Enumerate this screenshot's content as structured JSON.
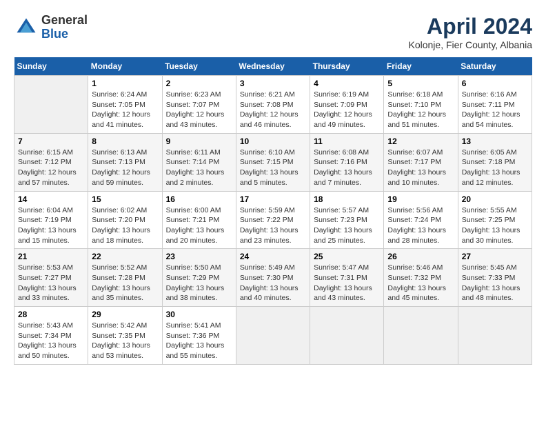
{
  "header": {
    "logo_line1": "General",
    "logo_line2": "Blue",
    "month": "April 2024",
    "location": "Kolonje, Fier County, Albania"
  },
  "weekdays": [
    "Sunday",
    "Monday",
    "Tuesday",
    "Wednesday",
    "Thursday",
    "Friday",
    "Saturday"
  ],
  "weeks": [
    [
      {
        "day": "",
        "sunrise": "",
        "sunset": "",
        "daylight": ""
      },
      {
        "day": "1",
        "sunrise": "Sunrise: 6:24 AM",
        "sunset": "Sunset: 7:05 PM",
        "daylight": "Daylight: 12 hours and 41 minutes."
      },
      {
        "day": "2",
        "sunrise": "Sunrise: 6:23 AM",
        "sunset": "Sunset: 7:07 PM",
        "daylight": "Daylight: 12 hours and 43 minutes."
      },
      {
        "day": "3",
        "sunrise": "Sunrise: 6:21 AM",
        "sunset": "Sunset: 7:08 PM",
        "daylight": "Daylight: 12 hours and 46 minutes."
      },
      {
        "day": "4",
        "sunrise": "Sunrise: 6:19 AM",
        "sunset": "Sunset: 7:09 PM",
        "daylight": "Daylight: 12 hours and 49 minutes."
      },
      {
        "day": "5",
        "sunrise": "Sunrise: 6:18 AM",
        "sunset": "Sunset: 7:10 PM",
        "daylight": "Daylight: 12 hours and 51 minutes."
      },
      {
        "day": "6",
        "sunrise": "Sunrise: 6:16 AM",
        "sunset": "Sunset: 7:11 PM",
        "daylight": "Daylight: 12 hours and 54 minutes."
      }
    ],
    [
      {
        "day": "7",
        "sunrise": "Sunrise: 6:15 AM",
        "sunset": "Sunset: 7:12 PM",
        "daylight": "Daylight: 12 hours and 57 minutes."
      },
      {
        "day": "8",
        "sunrise": "Sunrise: 6:13 AM",
        "sunset": "Sunset: 7:13 PM",
        "daylight": "Daylight: 12 hours and 59 minutes."
      },
      {
        "day": "9",
        "sunrise": "Sunrise: 6:11 AM",
        "sunset": "Sunset: 7:14 PM",
        "daylight": "Daylight: 13 hours and 2 minutes."
      },
      {
        "day": "10",
        "sunrise": "Sunrise: 6:10 AM",
        "sunset": "Sunset: 7:15 PM",
        "daylight": "Daylight: 13 hours and 5 minutes."
      },
      {
        "day": "11",
        "sunrise": "Sunrise: 6:08 AM",
        "sunset": "Sunset: 7:16 PM",
        "daylight": "Daylight: 13 hours and 7 minutes."
      },
      {
        "day": "12",
        "sunrise": "Sunrise: 6:07 AM",
        "sunset": "Sunset: 7:17 PM",
        "daylight": "Daylight: 13 hours and 10 minutes."
      },
      {
        "day": "13",
        "sunrise": "Sunrise: 6:05 AM",
        "sunset": "Sunset: 7:18 PM",
        "daylight": "Daylight: 13 hours and 12 minutes."
      }
    ],
    [
      {
        "day": "14",
        "sunrise": "Sunrise: 6:04 AM",
        "sunset": "Sunset: 7:19 PM",
        "daylight": "Daylight: 13 hours and 15 minutes."
      },
      {
        "day": "15",
        "sunrise": "Sunrise: 6:02 AM",
        "sunset": "Sunset: 7:20 PM",
        "daylight": "Daylight: 13 hours and 18 minutes."
      },
      {
        "day": "16",
        "sunrise": "Sunrise: 6:00 AM",
        "sunset": "Sunset: 7:21 PM",
        "daylight": "Daylight: 13 hours and 20 minutes."
      },
      {
        "day": "17",
        "sunrise": "Sunrise: 5:59 AM",
        "sunset": "Sunset: 7:22 PM",
        "daylight": "Daylight: 13 hours and 23 minutes."
      },
      {
        "day": "18",
        "sunrise": "Sunrise: 5:57 AM",
        "sunset": "Sunset: 7:23 PM",
        "daylight": "Daylight: 13 hours and 25 minutes."
      },
      {
        "day": "19",
        "sunrise": "Sunrise: 5:56 AM",
        "sunset": "Sunset: 7:24 PM",
        "daylight": "Daylight: 13 hours and 28 minutes."
      },
      {
        "day": "20",
        "sunrise": "Sunrise: 5:55 AM",
        "sunset": "Sunset: 7:25 PM",
        "daylight": "Daylight: 13 hours and 30 minutes."
      }
    ],
    [
      {
        "day": "21",
        "sunrise": "Sunrise: 5:53 AM",
        "sunset": "Sunset: 7:27 PM",
        "daylight": "Daylight: 13 hours and 33 minutes."
      },
      {
        "day": "22",
        "sunrise": "Sunrise: 5:52 AM",
        "sunset": "Sunset: 7:28 PM",
        "daylight": "Daylight: 13 hours and 35 minutes."
      },
      {
        "day": "23",
        "sunrise": "Sunrise: 5:50 AM",
        "sunset": "Sunset: 7:29 PM",
        "daylight": "Daylight: 13 hours and 38 minutes."
      },
      {
        "day": "24",
        "sunrise": "Sunrise: 5:49 AM",
        "sunset": "Sunset: 7:30 PM",
        "daylight": "Daylight: 13 hours and 40 minutes."
      },
      {
        "day": "25",
        "sunrise": "Sunrise: 5:47 AM",
        "sunset": "Sunset: 7:31 PM",
        "daylight": "Daylight: 13 hours and 43 minutes."
      },
      {
        "day": "26",
        "sunrise": "Sunrise: 5:46 AM",
        "sunset": "Sunset: 7:32 PM",
        "daylight": "Daylight: 13 hours and 45 minutes."
      },
      {
        "day": "27",
        "sunrise": "Sunrise: 5:45 AM",
        "sunset": "Sunset: 7:33 PM",
        "daylight": "Daylight: 13 hours and 48 minutes."
      }
    ],
    [
      {
        "day": "28",
        "sunrise": "Sunrise: 5:43 AM",
        "sunset": "Sunset: 7:34 PM",
        "daylight": "Daylight: 13 hours and 50 minutes."
      },
      {
        "day": "29",
        "sunrise": "Sunrise: 5:42 AM",
        "sunset": "Sunset: 7:35 PM",
        "daylight": "Daylight: 13 hours and 53 minutes."
      },
      {
        "day": "30",
        "sunrise": "Sunrise: 5:41 AM",
        "sunset": "Sunset: 7:36 PM",
        "daylight": "Daylight: 13 hours and 55 minutes."
      },
      {
        "day": "",
        "sunrise": "",
        "sunset": "",
        "daylight": ""
      },
      {
        "day": "",
        "sunrise": "",
        "sunset": "",
        "daylight": ""
      },
      {
        "day": "",
        "sunrise": "",
        "sunset": "",
        "daylight": ""
      },
      {
        "day": "",
        "sunrise": "",
        "sunset": "",
        "daylight": ""
      }
    ]
  ]
}
